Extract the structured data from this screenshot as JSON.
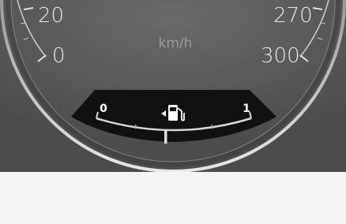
{
  "speedometer": {
    "unit": "km/h",
    "left_labels": [
      "20",
      "0"
    ],
    "right_labels": [
      "270",
      "300"
    ]
  },
  "fuel_gauge": {
    "min_label": "0",
    "max_label": "1",
    "icon": "fuel-pump-icon",
    "fill_side_arrow": "left-arrow-icon",
    "level": 0.5
  },
  "colors": {
    "background": "#5a5a5a",
    "ring": "#d0d0d0",
    "gauge_panel": "#111111",
    "text": "#ffffff",
    "footer": "#f4f4f4"
  }
}
